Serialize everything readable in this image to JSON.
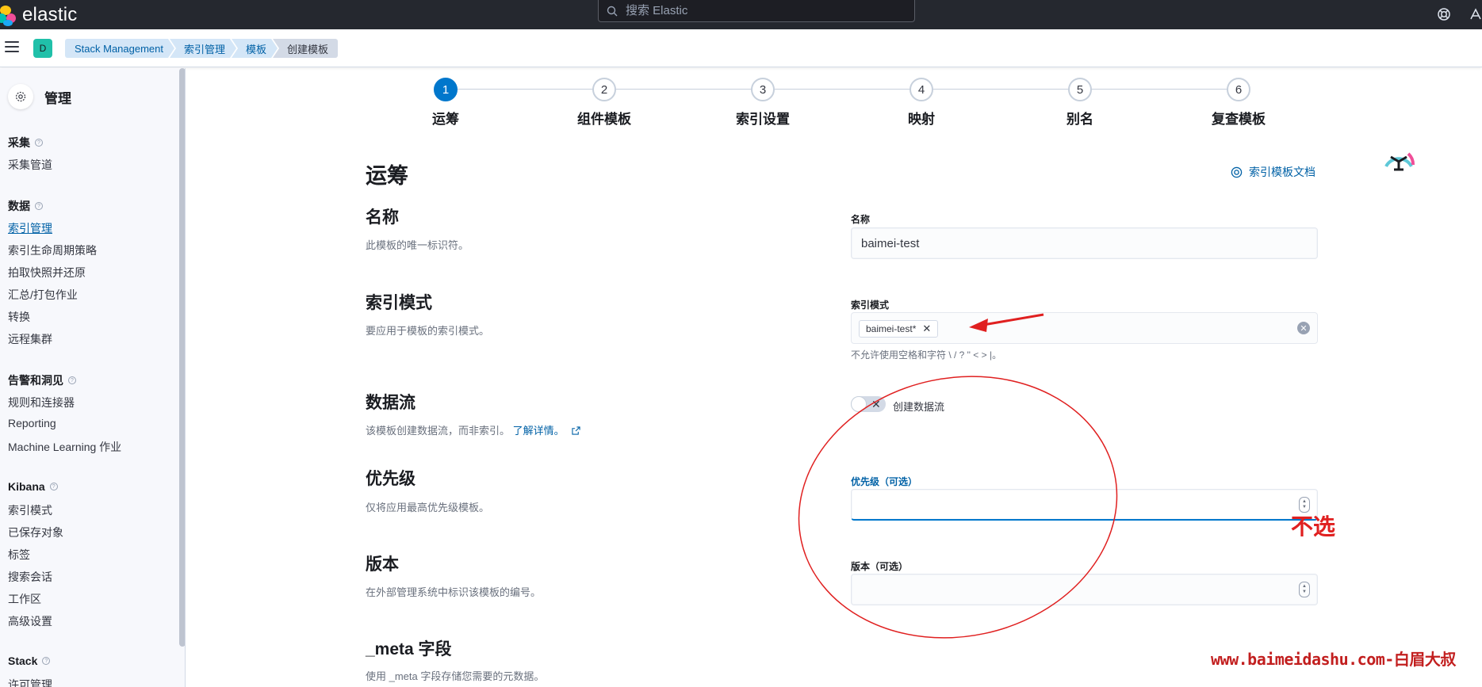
{
  "topbar": {
    "logo_text": "elastic",
    "search_placeholder": "搜索 Elastic",
    "icons": [
      "help-icon",
      "newsfeed-icon"
    ]
  },
  "breadcrumb": {
    "space_initial": "D",
    "items": [
      "Stack Management",
      "索引管理",
      "模板",
      "创建模板"
    ]
  },
  "sidebar": {
    "title": "管理",
    "groups": [
      {
        "label": "采集",
        "items": [
          "采集管道"
        ]
      },
      {
        "label": "数据",
        "items": [
          "索引管理",
          "索引生命周期策略",
          "拍取快照并还原",
          "汇总/打包作业",
          "转换",
          "远程集群"
        ]
      },
      {
        "label": "告警和洞见",
        "items": [
          "规则和连接器",
          "Reporting",
          "Machine Learning 作业"
        ]
      },
      {
        "label": "Kibana",
        "items": [
          "索引模式",
          "已保存对象",
          "标签",
          "搜索会话",
          "工作区",
          "高级设置"
        ]
      },
      {
        "label": "Stack",
        "items": [
          "许可管理"
        ]
      }
    ],
    "active_item": "索引管理"
  },
  "steps": [
    {
      "number": "1",
      "label": "运筹",
      "current": true
    },
    {
      "number": "2",
      "label": "组件模板"
    },
    {
      "number": "3",
      "label": "索引设置"
    },
    {
      "number": "4",
      "label": "映射"
    },
    {
      "number": "5",
      "label": "别名"
    },
    {
      "number": "6",
      "label": "复查模板"
    }
  ],
  "form": {
    "page_title": "运筹",
    "doc_link": "索引模板文档",
    "name": {
      "title": "名称",
      "desc": "此模板的唯一标识符。",
      "label": "名称",
      "value": "baimei-test"
    },
    "index_pattern": {
      "title": "索引模式",
      "desc": "要应用于模板的索引模式。",
      "label": "索引模式",
      "pill": "baimei-test*",
      "help": "不允许使用空格和字符 \\ / ? \" < > |。"
    },
    "data_stream": {
      "title": "数据流",
      "desc": "该模板创建数据流，而非索引。",
      "learn_more": "了解详情。",
      "toggle_label": "创建数据流"
    },
    "priority": {
      "title": "优先级",
      "desc": "仅将应用最高优先级模板。",
      "label": "优先级（可选）",
      "value": ""
    },
    "version": {
      "title": "版本",
      "desc": "在外部管理系统中标识该模板的编号。",
      "label": "版本（可选）",
      "value": ""
    },
    "meta": {
      "title": "_meta 字段",
      "desc": "使用 _meta 字段存储您需要的元数据。"
    }
  },
  "annotations": {
    "note": "不选",
    "watermark": "www.baimeidashu.com-白眉大叔",
    "color": "#e02020"
  }
}
